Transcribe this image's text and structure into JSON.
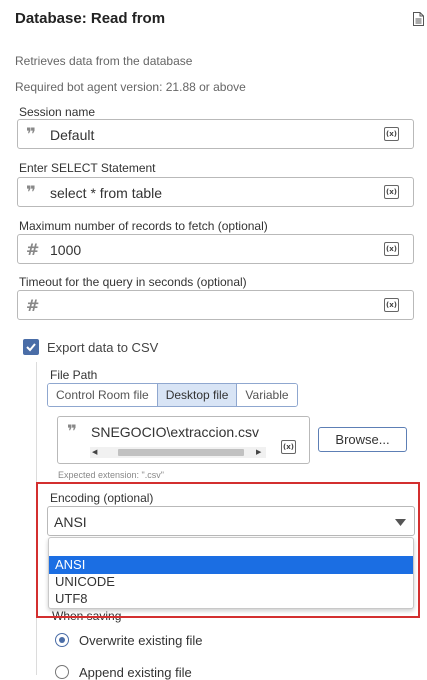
{
  "header": {
    "title": "Database: Read from",
    "description": "Retrieves data from the database",
    "version_note": "Required bot agent version: 21.88 or above"
  },
  "fields": {
    "session": {
      "label": "Session name",
      "value": "Default"
    },
    "select_statement": {
      "label": "Enter SELECT Statement",
      "value": "select * from table"
    },
    "max_records": {
      "label": "Maximum number of records to fetch (optional)",
      "value": "1000"
    },
    "timeout": {
      "label": "Timeout for the query in seconds (optional)",
      "value": ""
    },
    "variable_button_label": "(x)"
  },
  "export": {
    "checkbox_label": "Export data to CSV",
    "checked": true,
    "file_path_label": "File Path",
    "tabs": [
      "Control Room file",
      "Desktop file",
      "Variable"
    ],
    "active_tab": "Desktop file",
    "file_value": "SNEGOCIO\\extraccion.csv",
    "browse_label": "Browse...",
    "hint": "Expected extension: \".csv\""
  },
  "encoding": {
    "label": "Encoding (optional)",
    "selected": "ANSI",
    "options": [
      "ANSI",
      "UNICODE",
      "UTF8"
    ],
    "highlighted": "ANSI"
  },
  "when_saving": {
    "label": "When saving",
    "options": [
      "Overwrite existing file",
      "Append existing file"
    ],
    "selected": "Overwrite existing file"
  },
  "colors": {
    "accent": "#4a6da7",
    "highlight": "#1b6ee3",
    "annotation_red": "#d32f2f"
  }
}
